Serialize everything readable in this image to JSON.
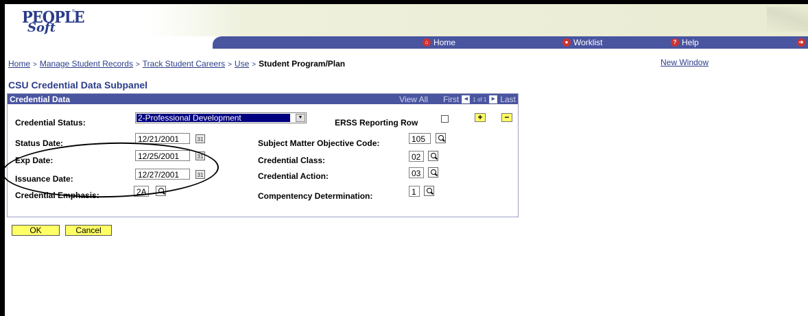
{
  "header": {
    "logo_line1": "PEOPLE",
    "logo_line2": "Soft",
    "logo_tm": "®",
    "nav": [
      {
        "label": "Home",
        "icon": "home-icon"
      },
      {
        "label": "Worklist",
        "icon": "worklist-icon"
      },
      {
        "label": "Help",
        "icon": "help-icon"
      }
    ]
  },
  "breadcrumb": {
    "items": [
      "Home",
      "Manage Student Records",
      "Track Student Careers",
      "Use"
    ],
    "separator": ">",
    "current": "Student Program/Plan"
  },
  "new_window": "New Window",
  "page_title": "CSU Credential Data Subpanel",
  "panel": {
    "title": "Credential Data",
    "view_all": "View All",
    "first": "First",
    "count": "1 of 1",
    "last": "Last"
  },
  "form": {
    "credential_status_label": "Credential Status:",
    "credential_status_value": "2-Professional Development",
    "erss_label": "ERSS Reporting Row",
    "status_date_label": "Status Date:",
    "status_date_value": "12/21/2001",
    "exp_date_label": "Exp Date:",
    "exp_date_value": "12/25/2001",
    "issuance_date_label": "Issuance Date:",
    "issuance_date_value": "12/27/2001",
    "emphasis_label": "Credential Emphasis:",
    "emphasis_value": "2A",
    "smo_label": "Subject Matter Objective Code:",
    "smo_value": "105",
    "class_label": "Credential Class:",
    "class_value": "02",
    "action_label": "Credential Action:",
    "action_value": "03",
    "competency_label": "Compentency Determination:",
    "competency_value": "1",
    "add_label": "+",
    "delete_label": "−"
  },
  "buttons": {
    "ok": "OK",
    "cancel": "Cancel"
  }
}
